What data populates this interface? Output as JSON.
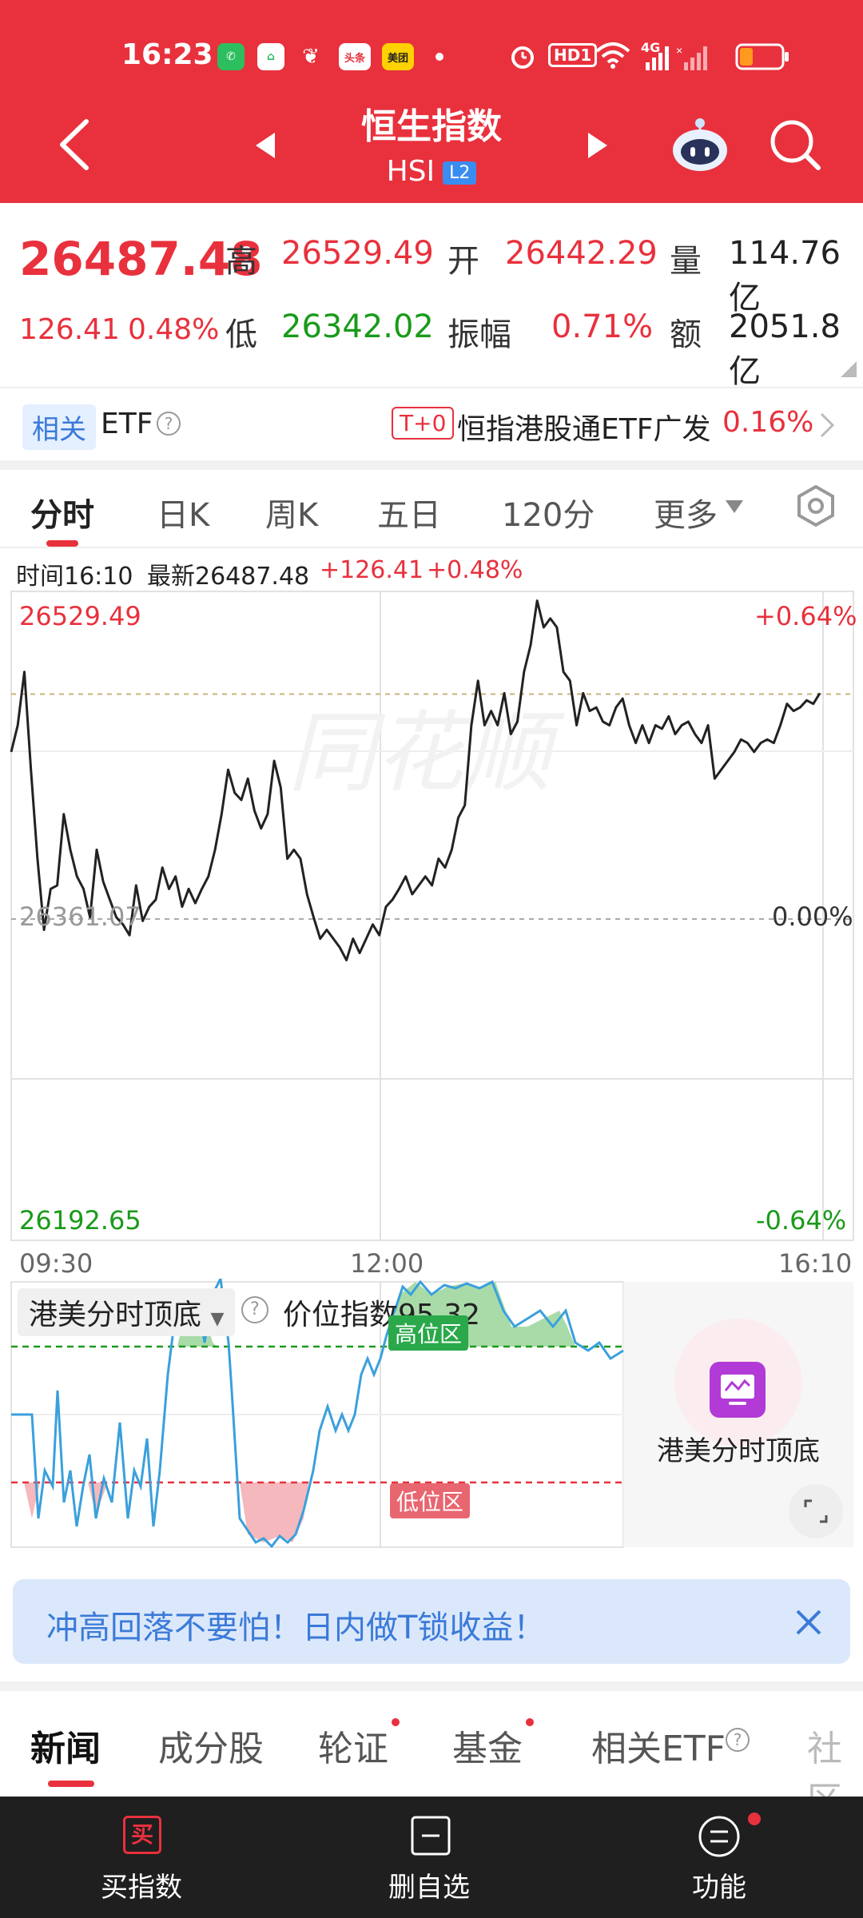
{
  "status_bar": {
    "time": "16:23",
    "icons": [
      "phone-app-icon",
      "home-app-icon",
      "feather-app-icon",
      "toutiao-app-icon",
      "meituan-app-icon",
      "dot-icon",
      "alarm-icon",
      "hd-icon",
      "wifi-icon",
      "signal-4g-icon",
      "signal-x-icon",
      "battery-icon"
    ],
    "toutiao": "头条",
    "meituan": "美团",
    "hd": "HD1",
    "network": "4G"
  },
  "header": {
    "title": "恒生指数",
    "code": "HSI",
    "level_badge": "L2"
  },
  "quote": {
    "price": "26487.48",
    "change": "126.41",
    "change_pct": "0.48%",
    "high_label": "高",
    "high": "26529.49",
    "low_label": "低",
    "low": "26342.02",
    "open_label": "开",
    "open": "26442.29",
    "amplitude_label": "振幅",
    "amplitude": "0.71%",
    "volume_label": "量",
    "volume": "114.76亿",
    "turnover_label": "额",
    "turnover": "2051.8亿"
  },
  "etf_row": {
    "badge": "相关",
    "label": "ETF",
    "help": "?",
    "t0": "T+0",
    "fund_name": "恒指港股通ETF广发",
    "fund_change": "0.16%"
  },
  "chart_tabs": [
    "分时",
    "日K",
    "周K",
    "五日",
    "120分",
    "更多"
  ],
  "chart_info": {
    "time_label": "时间16:10",
    "latest_label": "最新26487.48",
    "change": "+126.41",
    "change_pct": "+0.48%"
  },
  "chart_data": {
    "type": "line",
    "y_top": "26529.49",
    "y_mid": "26361.07",
    "y_bottom": "26192.65",
    "pct_top": "+0.64%",
    "pct_mid": "0.00%",
    "pct_bottom": "-0.64%",
    "x_labels": [
      "09:30",
      "12:00",
      "16:10"
    ],
    "ylim": [
      26192.65,
      26529.49
    ],
    "prev_close": 26361.07,
    "dashed_level": 26487.48,
    "series": [
      {
        "values": [
          26455,
          26470,
          26500,
          26445,
          26395,
          26355,
          26378,
          26380,
          26420,
          26400,
          26385,
          26378,
          26362,
          26400,
          26382,
          26372,
          26362,
          26358,
          26352,
          26380,
          26360,
          26368,
          26372,
          26390,
          26378,
          26385,
          26368,
          26378,
          26370,
          26378,
          26385,
          26400,
          26420,
          26445,
          26432,
          26428,
          26440,
          26422,
          26412,
          26420,
          26450,
          26435,
          26395,
          26400,
          26395,
          26375,
          26362,
          26350,
          26355,
          26350,
          26345,
          26338,
          26350,
          26342,
          26350,
          26358,
          26352,
          26368,
          26372,
          26378,
          26385,
          26375,
          26380,
          26385,
          26380,
          26395,
          26390,
          26400,
          26418,
          26425,
          26470,
          26495,
          26470,
          26478,
          26470,
          26488,
          26465,
          26472,
          26500,
          26515,
          26540,
          26525,
          26530,
          26525,
          26500,
          26495,
          26470,
          26488,
          26478,
          26480,
          26472,
          26470,
          26480,
          26485,
          26470,
          26460,
          26470,
          26460,
          26470,
          26468,
          26475,
          26465,
          26470,
          26472,
          26465,
          26460,
          26470,
          26440,
          26445,
          26450,
          26455,
          26462,
          26460,
          26455,
          26460,
          26462,
          26460,
          26470,
          26482,
          26478,
          26480,
          26484,
          26482,
          26488
        ]
      }
    ]
  },
  "indicator": {
    "name": "港美分时顶底",
    "help": "?",
    "value_label": "价位指数95.32",
    "high_zone": "高位区",
    "low_zone": "低位区",
    "card_title": "港美分时顶底"
  },
  "banner": {
    "text": "冲高回落不要怕！日内做T锁收益！"
  },
  "bottom_tabs": [
    "新闻",
    "成分股",
    "轮证",
    "基金",
    "相关ETF",
    "社区"
  ],
  "bottom_bar": {
    "buy_icon_text": "买",
    "buy_label": "买指数",
    "remove_label": "删自选",
    "func_label": "功能"
  },
  "colors": {
    "brand_red": "#e8313d",
    "up_red": "#e8313d",
    "down_green": "#1a9a1a",
    "indicator_blue": "#3aa0dc"
  }
}
